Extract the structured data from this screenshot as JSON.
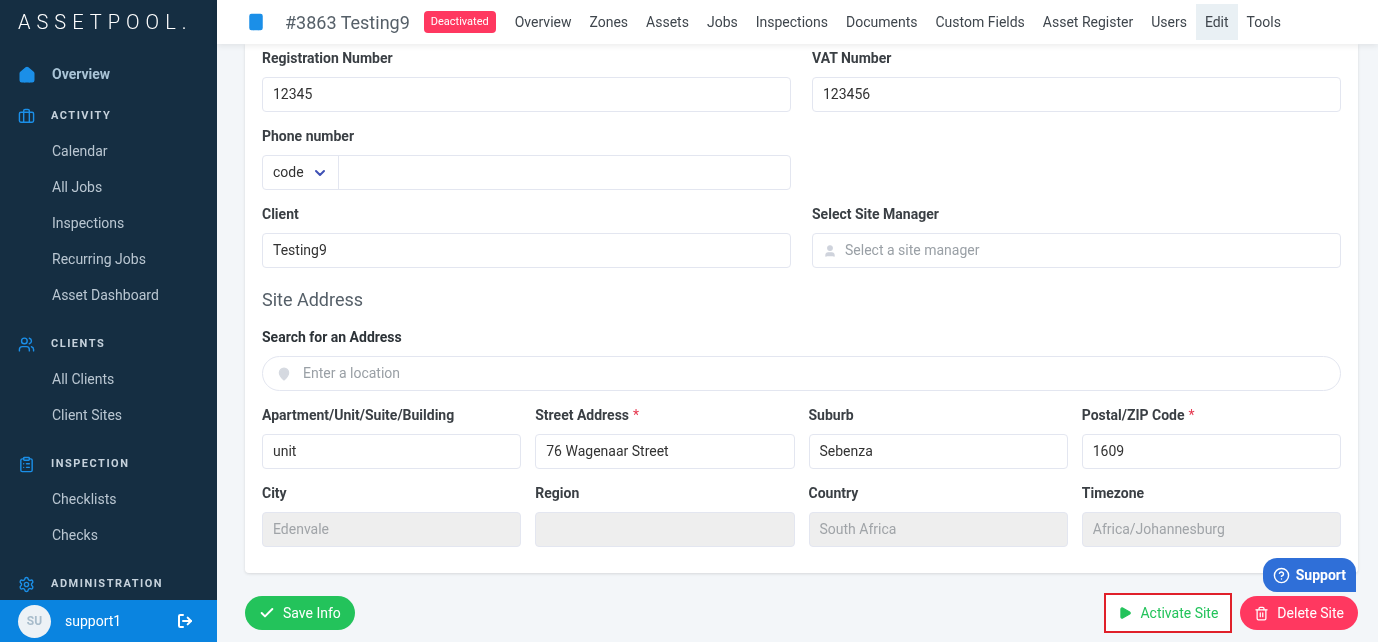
{
  "sidebar": {
    "logo": "ASSETPOOL.",
    "top": {
      "label": "Overview",
      "selected": true
    },
    "sections": [
      {
        "title": "ACTIVITY",
        "items": [
          "Calendar",
          "All Jobs",
          "Inspections",
          "Recurring Jobs",
          "Asset Dashboard"
        ]
      },
      {
        "title": "CLIENTS",
        "items": [
          "All Clients",
          "Client Sites"
        ]
      },
      {
        "title": "INSPECTION",
        "items": [
          "Checklists",
          "Checks"
        ]
      },
      {
        "title": "ADMINISTRATION"
      }
    ],
    "user": {
      "initials": "SU",
      "name": "support1"
    }
  },
  "header": {
    "title": "#3863 Testing9",
    "badge": "Deactivated",
    "tabs": [
      {
        "label": "Overview",
        "selected": false
      },
      {
        "label": "Zones",
        "selected": false
      },
      {
        "label": "Assets",
        "selected": false
      },
      {
        "label": "Jobs",
        "selected": false
      },
      {
        "label": "Inspections",
        "selected": false
      },
      {
        "label": "Documents",
        "selected": false
      },
      {
        "label": "Custom Fields",
        "selected": false
      },
      {
        "label": "Asset Register",
        "selected": false
      },
      {
        "label": "Users",
        "selected": false
      },
      {
        "label": "Edit",
        "selected": true
      },
      {
        "label": "Tools",
        "selected": false
      }
    ]
  },
  "form": {
    "top_rows": [
      [
        {
          "kind": "text",
          "label": "Registration Number",
          "value": "12345"
        },
        {
          "kind": "text",
          "label": "VAT Number",
          "value": "123456"
        }
      ],
      [
        {
          "kind": "phone",
          "label": "Phone number",
          "code": "code"
        }
      ],
      [
        {
          "kind": "text",
          "label": "Client",
          "value": "Testing9"
        },
        {
          "kind": "person",
          "label": "Select Site Manager",
          "placeholder": "Select a site manager"
        }
      ]
    ],
    "address_title": "Site Address",
    "required_mark": "*",
    "search": {
      "label": "Search for an Address",
      "placeholder": "Enter a location"
    },
    "address_rows": [
      [
        {
          "label": "Apartment/Unit/Suite/Building",
          "value": "unit",
          "required": false,
          "disabled": false
        },
        {
          "label": "Street Address",
          "value": "76 Wagenaar Street",
          "required": true,
          "disabled": false
        },
        {
          "label": "Suburb",
          "value": "Sebenza",
          "required": false,
          "disabled": false
        },
        {
          "label": "Postal/ZIP Code",
          "value": "1609",
          "required": true,
          "disabled": false
        }
      ],
      [
        {
          "label": "City",
          "value": "Edenvale",
          "required": false,
          "disabled": true
        },
        {
          "label": "Region",
          "required": false,
          "disabled": true
        },
        {
          "label": "Country",
          "value": "South Africa",
          "required": false,
          "disabled": true
        },
        {
          "label": "Timezone",
          "value": "Africa/Johannesburg",
          "required": false,
          "disabled": true
        }
      ]
    ]
  },
  "actions": {
    "save": "Save Info",
    "activate": "Activate Site",
    "delete": "Delete Site",
    "support": "Support"
  }
}
